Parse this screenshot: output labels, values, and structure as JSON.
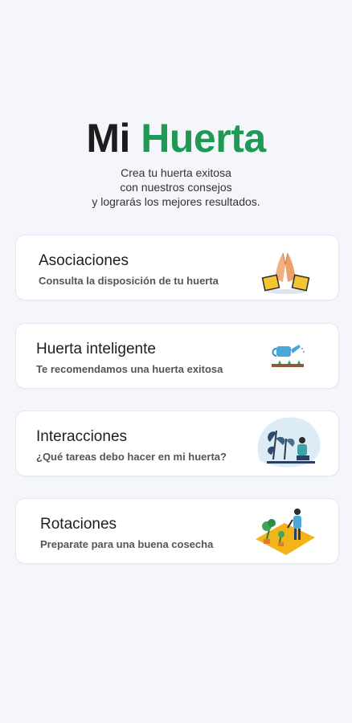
{
  "header": {
    "title_part1": "Mi",
    "title_part2": "Huerta",
    "subtitle_lines": [
      "Crea tu huerta exitosa",
      "con nuestros consejos",
      "y lograrás los mejores resultados."
    ]
  },
  "cards": [
    {
      "title": "Asociaciones",
      "subtitle": "Consulta la disposición de tu huerta",
      "icon": "praying-hands-icon"
    },
    {
      "title": "Huerta inteligente",
      "subtitle": "Te recomendamos una huerta exitosa",
      "icon": "watering-can-icon"
    },
    {
      "title": "Interacciones",
      "subtitle": "¿Qué tareas debo hacer en mi huerta?",
      "icon": "gardener-plants-icon"
    },
    {
      "title": "Rotaciones",
      "subtitle": "Preparate para una buena cosecha",
      "icon": "garden-plot-icon"
    }
  ],
  "colors": {
    "accent": "#1f9a55",
    "background": "#f4f6fb"
  }
}
